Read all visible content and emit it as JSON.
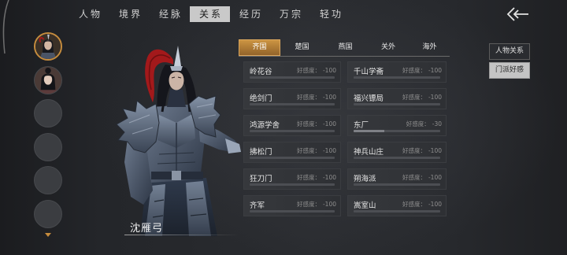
{
  "nav": {
    "tabs": [
      {
        "label": "人物",
        "active": false
      },
      {
        "label": "境界",
        "active": false
      },
      {
        "label": "经脉",
        "active": false
      },
      {
        "label": "关系",
        "active": true
      },
      {
        "label": "经历",
        "active": false
      },
      {
        "label": "万宗",
        "active": false
      },
      {
        "label": "轻功",
        "active": false
      }
    ],
    "back_icon": "back-arrow-icon"
  },
  "roster": {
    "avatars": [
      {
        "icon": "portrait-warrior-icon",
        "selected": true
      },
      {
        "icon": "portrait-woman-icon",
        "selected": false
      },
      {
        "icon": "empty-slot-icon",
        "selected": false
      },
      {
        "icon": "empty-slot-icon",
        "selected": false
      },
      {
        "icon": "empty-slot-icon",
        "selected": false
      },
      {
        "icon": "empty-slot-icon",
        "selected": false
      }
    ],
    "scroll_icon": "chevron-down-icon"
  },
  "character": {
    "name": "沈雁弓"
  },
  "factions": {
    "regions": [
      {
        "label": "齐国",
        "active": true
      },
      {
        "label": "楚国",
        "active": false
      },
      {
        "label": "燕国",
        "active": false
      },
      {
        "label": "关外",
        "active": false
      },
      {
        "label": "海外",
        "active": false
      }
    ],
    "affinity_label": "好感度：",
    "list": [
      {
        "name": "岭花谷",
        "affinity": -100
      },
      {
        "name": "千山学斋",
        "affinity": -100
      },
      {
        "name": "绝剑门",
        "affinity": -100
      },
      {
        "name": "福兴镖局",
        "affinity": -100
      },
      {
        "name": "鸿源学舍",
        "affinity": -100
      },
      {
        "name": "东厂",
        "affinity": -30
      },
      {
        "name": "拂松门",
        "affinity": -100
      },
      {
        "name": "神兵山庄",
        "affinity": -100
      },
      {
        "name": "狂刀门",
        "affinity": -100
      },
      {
        "name": "朔海派",
        "affinity": -100
      },
      {
        "name": "齐军",
        "affinity": -100
      },
      {
        "name": "嵩室山",
        "affinity": -100
      }
    ]
  },
  "side_menu": {
    "items": [
      {
        "label": "人物关系",
        "active": false
      },
      {
        "label": "门派好感",
        "active": true
      }
    ]
  },
  "colors": {
    "background": "#25272b",
    "accent": "#c68c3d",
    "tab_active": "#c9c9c9",
    "card": "#2e3034",
    "muted_text": "#8e8e8e"
  }
}
